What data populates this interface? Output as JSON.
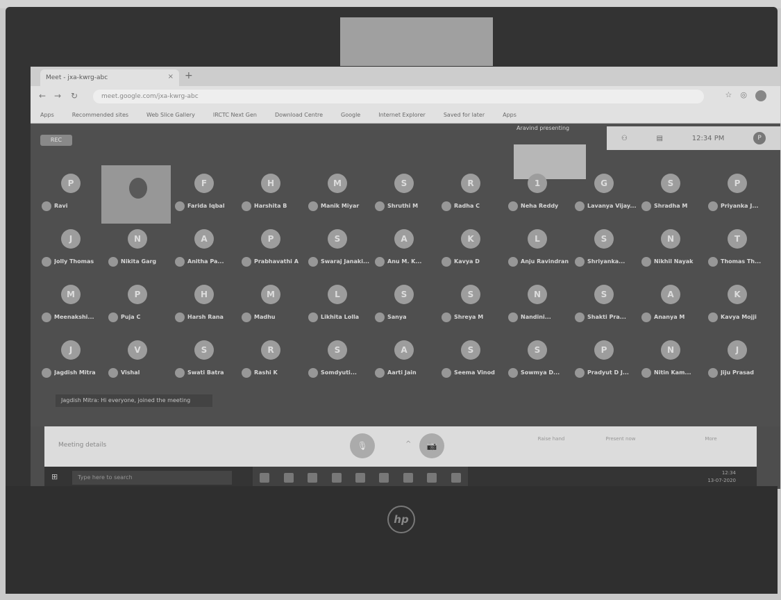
{
  "browser": {
    "tab_title": "Meet - jxa-kwrg-abc",
    "new_tab": "+",
    "tab_close": "×",
    "address": "meet.google.com/jxa-kwrg-abc",
    "bookmarks": [
      "Apps",
      "Recommended sites",
      "Web Slice Gallery",
      "IRCTC Next Gen",
      "Download Centre",
      "Google",
      "Internet Explorer",
      "Saved for later",
      "Apps"
    ]
  },
  "meet": {
    "rec_label": "REC",
    "presenter_label": "Aravind presenting",
    "clock": "12:34 PM",
    "self_avatar": "P",
    "toast": "Jagdish Mitra: Hi everyone, joined the meeting",
    "participants": [
      {
        "initial": "P",
        "name": "Ravi"
      },
      {
        "initial": "",
        "name": ""
      },
      {
        "initial": "F",
        "name": "Farida Iqbal"
      },
      {
        "initial": "H",
        "name": "Harshita B"
      },
      {
        "initial": "M",
        "name": "Manik Miyar"
      },
      {
        "initial": "S",
        "name": "Shruthi M"
      },
      {
        "initial": "R",
        "name": "Radha C"
      },
      {
        "initial": "1",
        "name": "Neha Reddy"
      },
      {
        "initial": "G",
        "name": "Lavanya Vijay..."
      },
      {
        "initial": "S",
        "name": "Shradha M"
      },
      {
        "initial": "P",
        "name": "Priyanka J..."
      },
      {
        "initial": "J",
        "name": "Jolly Thomas"
      },
      {
        "initial": "N",
        "name": "Nikita Garg"
      },
      {
        "initial": "A",
        "name": "Anitha Pa..."
      },
      {
        "initial": "P",
        "name": "Prabhavathi A"
      },
      {
        "initial": "S",
        "name": "Swaraj Janaki..."
      },
      {
        "initial": "A",
        "name": "Anu M. K..."
      },
      {
        "initial": "K",
        "name": "Kavya D"
      },
      {
        "initial": "L",
        "name": "Anju Ravindran"
      },
      {
        "initial": "S",
        "name": "Shriyanka..."
      },
      {
        "initial": "N",
        "name": "Nikhil Nayak"
      },
      {
        "initial": "T",
        "name": "Thomas Th..."
      },
      {
        "initial": "M",
        "name": "Meenakshi..."
      },
      {
        "initial": "P",
        "name": "Puja C"
      },
      {
        "initial": "H",
        "name": "Harsh Rana"
      },
      {
        "initial": "M",
        "name": "Madhu"
      },
      {
        "initial": "L",
        "name": "Likhita Lolla"
      },
      {
        "initial": "S",
        "name": "Sanya"
      },
      {
        "initial": "S",
        "name": "Shreya M"
      },
      {
        "initial": "N",
        "name": "Nandini..."
      },
      {
        "initial": "S",
        "name": "Shakti Pra..."
      },
      {
        "initial": "A",
        "name": "Ananya M"
      },
      {
        "initial": "K",
        "name": "Kavya Mojji"
      },
      {
        "initial": "J",
        "name": "Jagdish Mitra"
      },
      {
        "initial": "V",
        "name": "Vishal"
      },
      {
        "initial": "S",
        "name": "Swati Batra"
      },
      {
        "initial": "R",
        "name": "Rashi K"
      },
      {
        "initial": "S",
        "name": "Somdyuti..."
      },
      {
        "initial": "A",
        "name": "Aarti Jain"
      },
      {
        "initial": "S",
        "name": "Seema Vinod"
      },
      {
        "initial": "S",
        "name": "Sowmya D..."
      },
      {
        "initial": "P",
        "name": "Pradyut D J..."
      },
      {
        "initial": "N",
        "name": "Nitin Kam..."
      },
      {
        "initial": "J",
        "name": "Jiju Prasad"
      }
    ]
  },
  "controls": {
    "meeting_details": "Meeting details",
    "arrow": "^",
    "mic_glyph": "🎙",
    "cam_glyph": "📷",
    "raise_hand": "Raise hand",
    "present_now": "Present now",
    "more": "More"
  },
  "taskbar": {
    "start_glyph": "⊞",
    "search_placeholder": "Type here to search",
    "time": "12:34",
    "date": "13-07-2020"
  }
}
